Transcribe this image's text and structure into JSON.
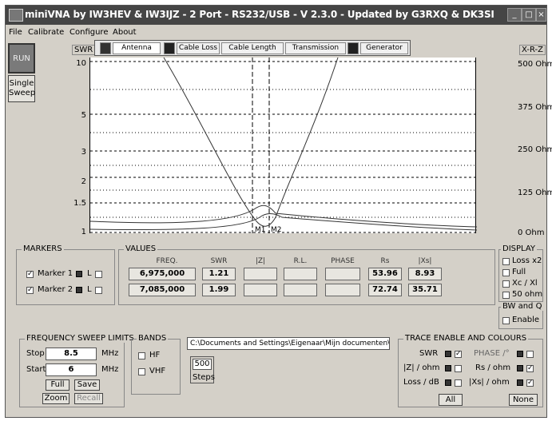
{
  "window": {
    "title": "miniVNA by IW3HEV & IW3IJZ - 2 Port - RS232/USB - V 2.3.0 - Updated by G3RXQ & DK3SI"
  },
  "menu": [
    "File",
    "Calibrate",
    "Configure",
    "About"
  ],
  "left": {
    "run": "RUN",
    "single_line1": "Single",
    "single_line2": "Sweep"
  },
  "plot": {
    "left_unit": "SWR",
    "right_unit": "X-R-Z",
    "tabs": [
      "Antenna",
      "Cable Loss",
      "Cable Length",
      "Transmission",
      "Generator"
    ],
    "yticks": [
      "10",
      "5",
      "3",
      "2",
      "1.5",
      "1"
    ],
    "rticks": [
      "500 Ohm",
      "375 Ohm",
      "250 Ohm",
      "125 Ohm",
      "0 Ohm"
    ],
    "marker_labels": [
      "M1",
      "M2"
    ]
  },
  "markers": {
    "title": "MARKERS",
    "m1": "Marker 1",
    "m2": "Marker 2",
    "l": "L"
  },
  "values": {
    "title": "VALUES",
    "headers": [
      "FREQ.",
      "SWR",
      "|Z|",
      "R.L.",
      "PHASE",
      "Rs",
      "|Xs|"
    ],
    "row1": {
      "freq": "6,975,000",
      "swr": "1.21",
      "z": "",
      "rl": "",
      "phase": "",
      "rs": "53.96",
      "xs": "8.93"
    },
    "row2": {
      "freq": "7,085,000",
      "swr": "1.99",
      "z": "",
      "rl": "",
      "phase": "",
      "rs": "72.74",
      "xs": "35.71"
    }
  },
  "display": {
    "title": "DISPLAY",
    "opts": [
      "Loss x2",
      "Full",
      "Xc / Xl",
      "50 ohm"
    ]
  },
  "bwq": {
    "title": "BW and Q",
    "enable": "Enable"
  },
  "sweep": {
    "title": "FREQUENCY SWEEP LIMITS",
    "stop_label": "Stop",
    "stop": "8.5",
    "start_label": "Start",
    "start": "6",
    "unit": "MHz",
    "full": "Full",
    "save": "Save",
    "zoom": "Zoom",
    "recall": "Recall"
  },
  "bands": {
    "title": "BANDS",
    "hf": "HF",
    "vhf": "VHF"
  },
  "path": "C:\\Documents and Settings\\Eigenaar\\Mijn documenten\\Scr",
  "steps": {
    "value": "500",
    "label": "Steps"
  },
  "trace": {
    "title": "TRACE ENABLE AND COLOURS",
    "swr": "SWR",
    "phase": "PHASE /°",
    "z": "|Z| / ohm",
    "rs": "Rs / ohm",
    "loss": "Loss / dB",
    "xs": "|Xs| / ohm",
    "all": "All",
    "none": "None"
  }
}
